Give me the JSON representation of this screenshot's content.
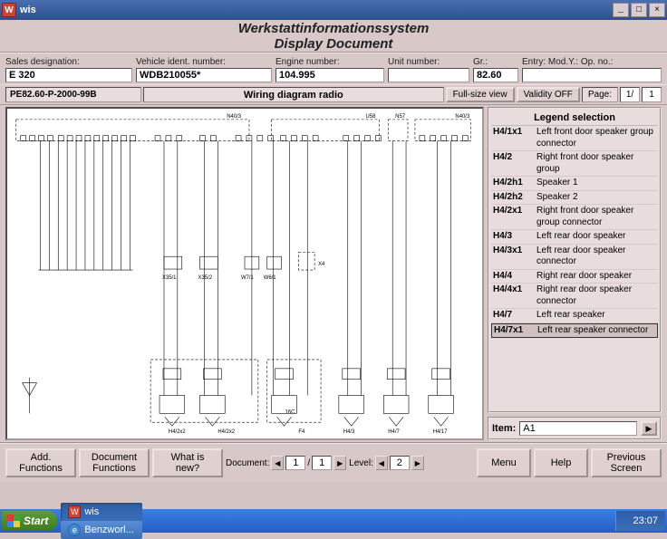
{
  "window": {
    "title": "wis",
    "minimize": "_",
    "maximize": "□",
    "close": "×"
  },
  "header": {
    "line1": "Werkstattinformationssystem",
    "line2": "Display Document"
  },
  "info": {
    "sales_label": "Sales designation:",
    "sales_value": "E 320",
    "vin_label": "Vehicle ident. number:",
    "vin_value": "WDB210055*",
    "engine_label": "Engine number:",
    "engine_value": "104.995",
    "unit_label": "Unit number:",
    "unit_value": "",
    "gr_label": "Gr.:",
    "gr_value": "82.60",
    "entry_label": "Entry: Mod.Y.: Op. no.:",
    "entry_value": ""
  },
  "doc": {
    "id": "PE82.60-P-2000-99B",
    "title": "Wiring diagram radio",
    "fullsize": "Full-size view",
    "validity": "Validity OFF",
    "page_label": "Page:",
    "page_cur": "1/",
    "page_total": "1"
  },
  "diagram": {
    "labels": [
      "N40/3",
      "U58",
      "N57",
      "N40/3",
      "X35/1",
      "X35/2",
      "W7/1",
      "W6/1",
      "X4",
      "16C",
      "F4",
      "H4/3",
      "H4/7",
      "H4/17",
      "H4/2x2",
      "H4/2x2"
    ]
  },
  "legend": {
    "title": "Legend selection",
    "items": [
      {
        "code": "H4/1x1",
        "desc": "Left front door speaker group connector"
      },
      {
        "code": "H4/2",
        "desc": "Right front door speaker group"
      },
      {
        "code": "H4/2h1",
        "desc": "Speaker 1"
      },
      {
        "code": "H4/2h2",
        "desc": "Speaker 2"
      },
      {
        "code": "H4/2x1",
        "desc": "Right front door speaker group connector"
      },
      {
        "code": "H4/3",
        "desc": "Left rear door speaker"
      },
      {
        "code": "H4/3x1",
        "desc": "Left rear door speaker connector"
      },
      {
        "code": "H4/4",
        "desc": "Right rear door speaker"
      },
      {
        "code": "H4/4x1",
        "desc": "Right rear door speaker connector"
      },
      {
        "code": "H4/7",
        "desc": "Left rear speaker"
      },
      {
        "code": "H4/7x1",
        "desc": "Left rear speaker connector"
      }
    ],
    "selected_index": 10
  },
  "item": {
    "label": "Item:",
    "value": "A1",
    "nav": "▶"
  },
  "toolbar": {
    "add_functions": "Add. Functions",
    "document_functions": "Document Functions",
    "whats_new": "What is new?",
    "document_label": "Document:",
    "document_cur": "1",
    "document_total": "1",
    "level_label": "Level:",
    "level_value": "2",
    "menu": "Menu",
    "help": "Help",
    "previous": "Previous Screen"
  },
  "taskbar": {
    "start": "Start",
    "tasks": [
      {
        "icon": "wis",
        "label": "wis"
      },
      {
        "icon": "ie",
        "label": "Benzworl..."
      }
    ],
    "clock": "23:07"
  }
}
